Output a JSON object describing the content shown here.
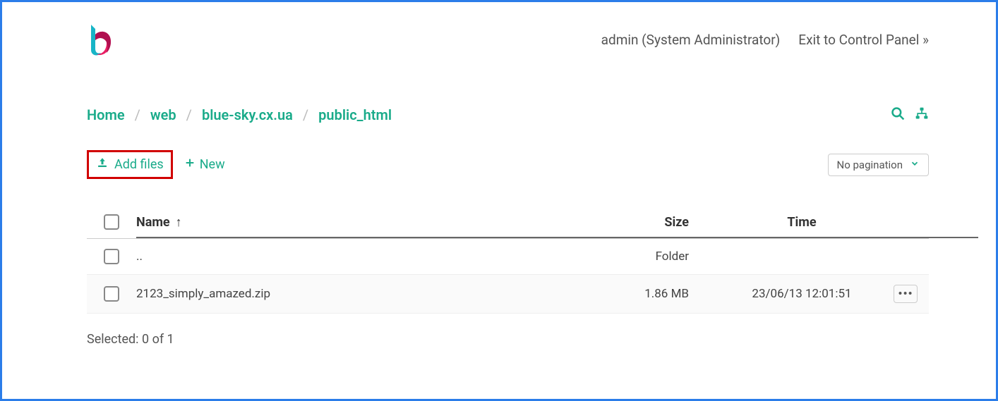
{
  "header": {
    "user_label": "admin (System Administrator)",
    "exit_label": "Exit to Control Panel »"
  },
  "breadcrumb": {
    "items": [
      "Home",
      "web",
      "blue-sky.cx.ua",
      "public_html"
    ]
  },
  "toolbar": {
    "add_files_label": "Add files",
    "new_label": "New",
    "pagination_label": "No pagination"
  },
  "table": {
    "columns": {
      "name": "Name",
      "size": "Size",
      "time": "Time"
    },
    "sort_column": "name",
    "sort_dir": "asc",
    "rows": [
      {
        "name": "..",
        "size": "Folder",
        "time": "",
        "actions": false
      },
      {
        "name": "2123_simply_amazed.zip",
        "size": "1.86 MB",
        "time": "23/06/13 12:01:51",
        "actions": true
      }
    ]
  },
  "status": {
    "selected_label": "Selected: 0 of 1"
  }
}
